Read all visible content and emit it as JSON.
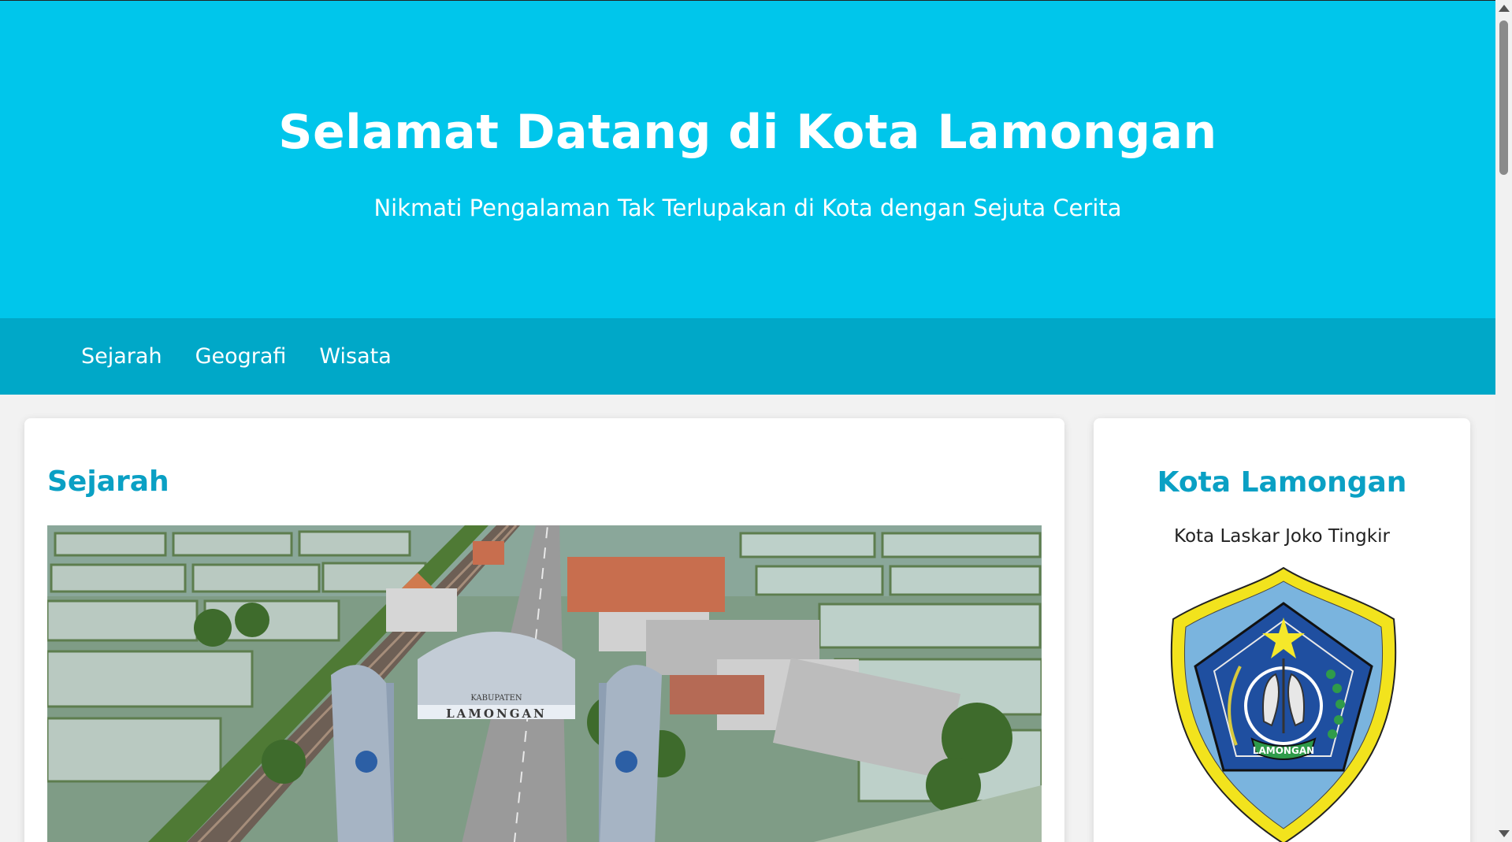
{
  "hero": {
    "title": "Selamat Datang di Kota Lamongan",
    "subtitle": "Nikmati Pengalaman Tak Terlupakan di Kota dengan Sejuta Cerita"
  },
  "nav": {
    "items": [
      {
        "label": "Sejarah"
      },
      {
        "label": "Geografi"
      },
      {
        "label": "Wisata"
      }
    ]
  },
  "main": {
    "section_title": "Sejarah",
    "photo": {
      "gate_sign_top": "KABUPATEN",
      "gate_sign": "LAMONGAN"
    }
  },
  "sidebar": {
    "title": "Kota Lamongan",
    "tagline": "Kota Laskar Joko Tingkir",
    "emblem_label": "LAMONGAN"
  },
  "colors": {
    "hero_bg": "#00c6eb",
    "nav_bg": "#00a8c8",
    "heading": "#0aa0c4",
    "emblem_outer": "#f2e31d",
    "emblem_inner": "#7ab4de",
    "emblem_pentagon": "#1f4fa0"
  },
  "icons": [
    "scroll-up-arrow-icon",
    "scroll-down-arrow-icon",
    "star-icon"
  ]
}
